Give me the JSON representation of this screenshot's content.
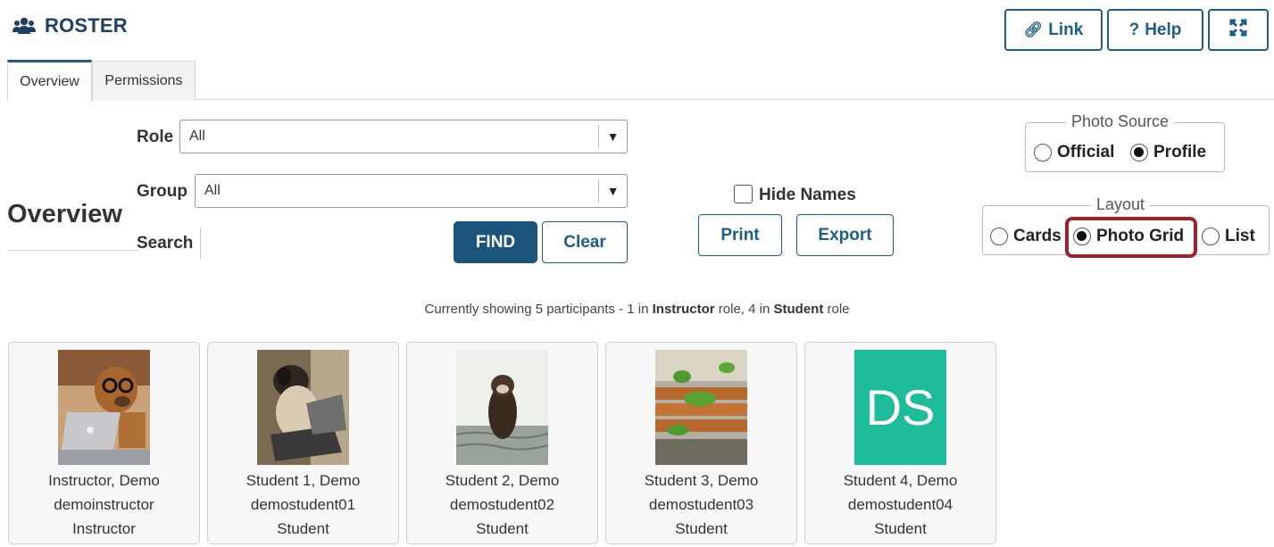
{
  "header": {
    "title": "ROSTER"
  },
  "top_buttons": {
    "link": "Link",
    "help": "Help",
    "help_prefix": "?"
  },
  "tabs": [
    {
      "label": "Overview"
    },
    {
      "label": "Permissions"
    }
  ],
  "overview_heading": "Overview",
  "filters": {
    "role_label": "Role",
    "role_value": "All",
    "group_label": "Group",
    "group_value": "All",
    "search_label": "Search",
    "search_value": "",
    "find_label": "FIND",
    "clear_label": "Clear"
  },
  "hide_names_label": "Hide Names",
  "print_label": "Print",
  "export_label": "Export",
  "photo_source": {
    "legend": "Photo Source",
    "options": [
      "Official",
      "Profile"
    ],
    "selected": "Profile"
  },
  "layout": {
    "legend": "Layout",
    "options": [
      "Cards",
      "Photo Grid",
      "List"
    ],
    "selected": "Photo Grid"
  },
  "status": {
    "prefix": "Currently showing 5 participants - 1 in ",
    "role1": "Instructor",
    "middle": " role, 4 in ",
    "role2": "Student",
    "suffix": " role"
  },
  "participants": [
    {
      "name": "Instructor, Demo",
      "username": "demoinstructor",
      "role": "Instructor"
    },
    {
      "name": "Student 1, Demo",
      "username": "demostudent01",
      "role": "Student"
    },
    {
      "name": "Student 2, Demo",
      "username": "demostudent02",
      "role": "Student"
    },
    {
      "name": "Student 3, Demo",
      "username": "demostudent03",
      "role": "Student"
    },
    {
      "name": "Student 4, Demo",
      "username": "demostudent04",
      "role": "Student",
      "initials": "DS"
    }
  ],
  "colors": {
    "primary": "#1b557c",
    "highlight": "#a31f27",
    "initials_bg": "#1fbc9c"
  }
}
